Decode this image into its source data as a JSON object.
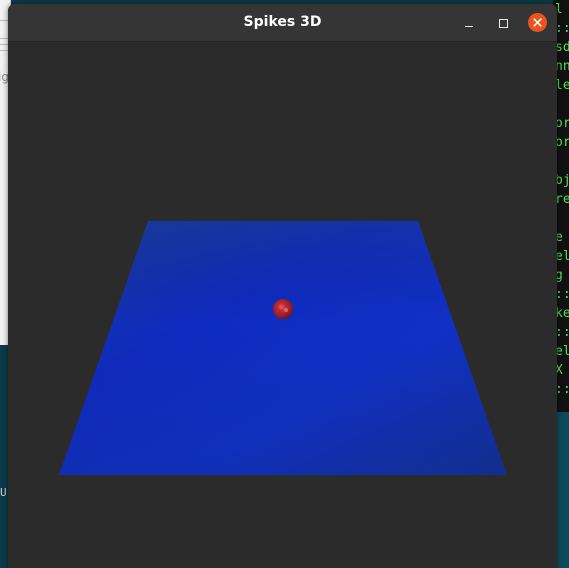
{
  "window": {
    "title": "Spikes 3D"
  },
  "titlebar_controls": {
    "minimize_icon": "minimize-icon",
    "maximize_icon": "maximize-icon",
    "close_icon": "close-icon"
  },
  "scene": {
    "background_color": "#2b2b2b",
    "plane_color": "#1029b8",
    "sphere_color": "#b3222e"
  },
  "background": {
    "left_window_fragment": "ig",
    "left_glyph": "U",
    "terminal_lines": [
      "l",
      "::",
      "sd",
      "nn",
      "le",
      "",
      "or",
      "or",
      "",
      "bj",
      "re",
      "",
      "e",
      "el",
      "g",
      "::",
      "ke",
      "::",
      "el",
      "X",
      "::"
    ]
  }
}
